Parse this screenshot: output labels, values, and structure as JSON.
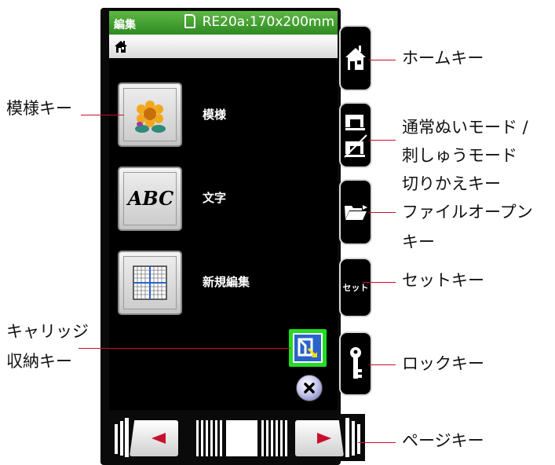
{
  "title_bar": {
    "left": "編集",
    "right": "RE20a:170x200mm"
  },
  "menu": {
    "pattern_label": "模様",
    "text_label": "文字",
    "text_button_glyph": "ABC",
    "new_edit_label": "新規編集"
  },
  "side_keys": {
    "set_label": "セット"
  },
  "annotations": {
    "pattern_key": "模様キー",
    "carriage_key_line1": "キャリッジ",
    "carriage_key_line2": "収納キー",
    "home_key": "ホームキー",
    "mode_key_line1": "通常ぬいモード /",
    "mode_key_line2": "刺しゅうモード",
    "mode_key_line3": "切りかえキー",
    "file_open_line1": "ファイルオープン",
    "file_open_line2": "キー",
    "set_key": "セットキー",
    "lock_key": "ロックキー",
    "page_key": "ページキー"
  },
  "colors": {
    "title_green": "#3c9c2c",
    "accent_red": "#d0102e",
    "highlight_green": "#22dd22",
    "blue": "#2a64c8"
  },
  "icons": [
    "house-icon",
    "sewing-machine-icon",
    "folder-open-icon",
    "key-icon",
    "carriage-icon",
    "close-icon",
    "flower-icon",
    "grid-icon"
  ]
}
